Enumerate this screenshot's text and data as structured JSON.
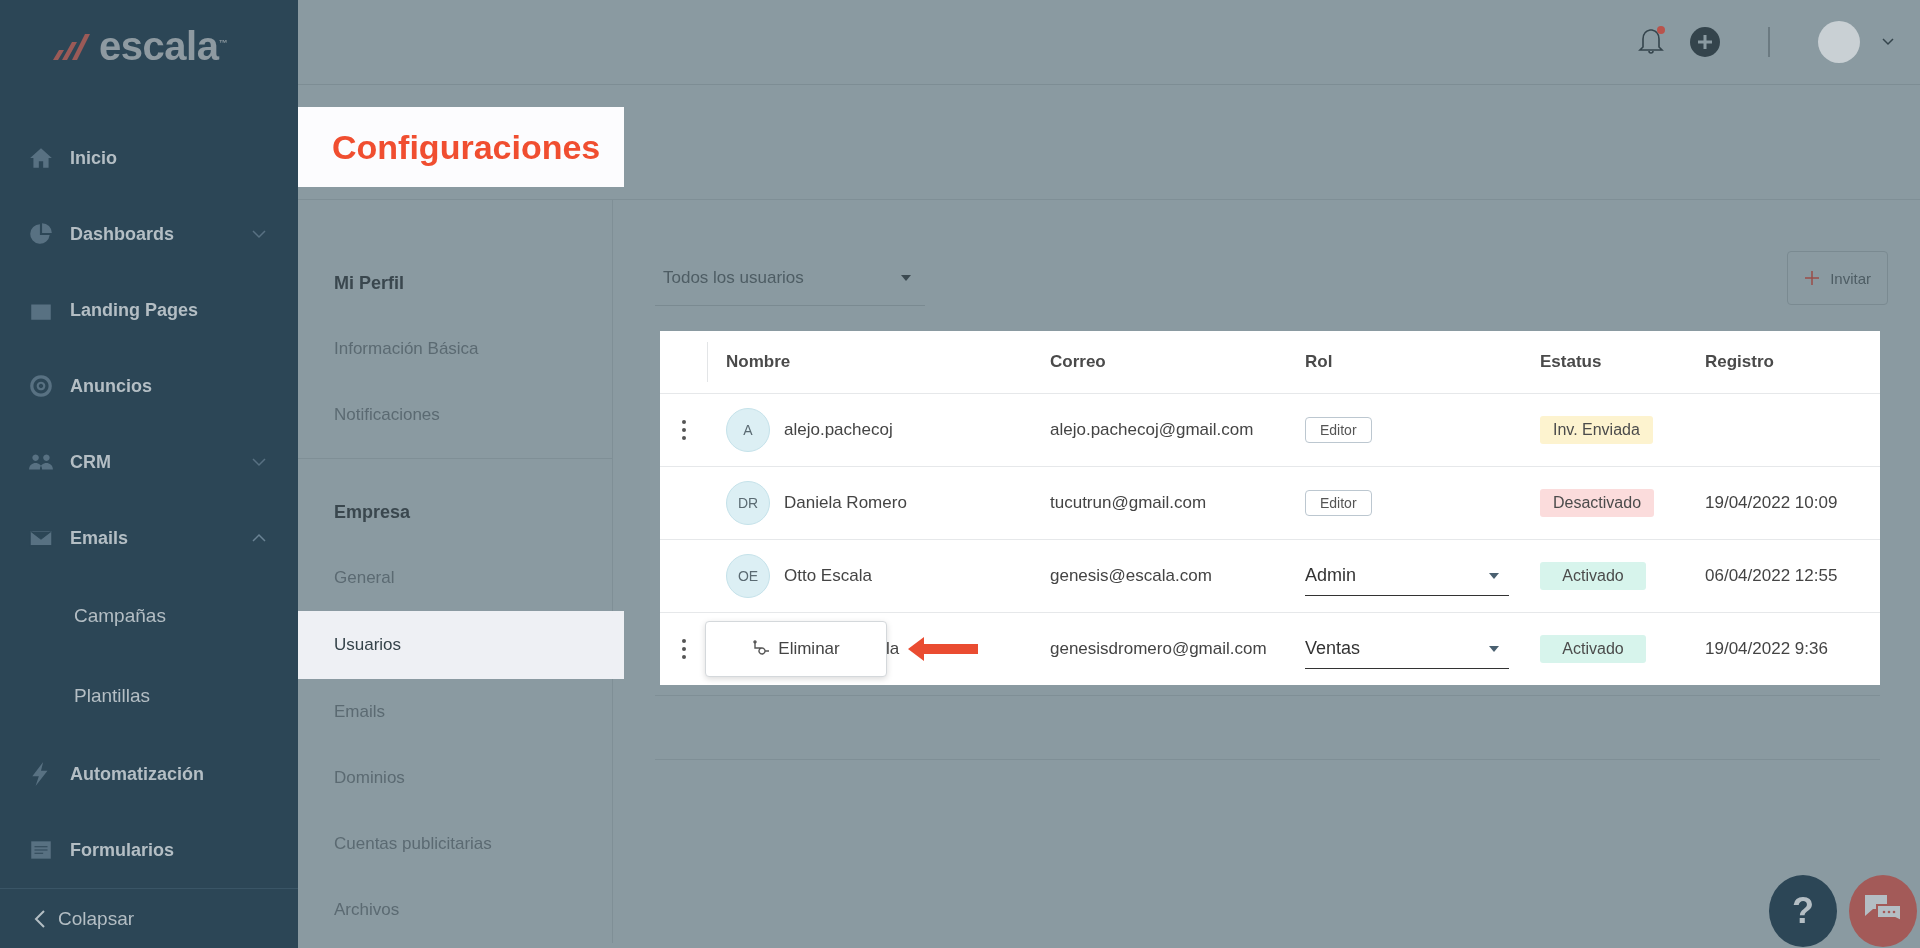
{
  "brand": {
    "name": "escala$^{™}$"
  },
  "sidebar": {
    "items": [
      {
        "label": "Inicio"
      },
      {
        "label": "Dashboards",
        "expanded": false
      },
      {
        "label": "Landing Pages"
      },
      {
        "label": "Anuncios"
      },
      {
        "label": "CRM",
        "expanded": false
      },
      {
        "label": "Emails",
        "expanded": true,
        "children": [
          {
            "label": "Campañas"
          },
          {
            "label": "Plantillas"
          }
        ]
      },
      {
        "label": "Automatización"
      },
      {
        "label": "Formularios"
      }
    ],
    "collapse_label": "Colapsar"
  },
  "topbar": {
    "notifications_unread": true
  },
  "page_title": "Configuraciones",
  "settings_nav": {
    "sections": [
      {
        "heading": "Mi Perfil",
        "items": [
          {
            "label": "Información Básica",
            "selected": false
          },
          {
            "label": "Notificaciones",
            "selected": false
          }
        ]
      },
      {
        "heading": "Empresa",
        "items": [
          {
            "label": "General",
            "selected": false
          },
          {
            "label": "Usuarios",
            "selected": true
          },
          {
            "label": "Emails",
            "selected": false
          },
          {
            "label": "Dominios",
            "selected": false
          },
          {
            "label": "Cuentas publicitarias",
            "selected": false
          },
          {
            "label": "Archivos",
            "selected": false
          }
        ]
      }
    ]
  },
  "filter": {
    "value": "Todos los usuarios"
  },
  "invite_button": {
    "label": "Invitar"
  },
  "table": {
    "columns": [
      "Nombre",
      "Correo",
      "Rol",
      "Estatus",
      "Registro"
    ],
    "rows": [
      {
        "menu_dots": true,
        "menu_open": false,
        "initials": "A",
        "name": "alejo.pachecoj",
        "email": "alejo.pachecoj@gmail.com",
        "role": {
          "kind": "tag",
          "label": "Editor"
        },
        "status": {
          "label": "Inv. Enviada",
          "color": "#fdf3cf"
        }
      },
      {
        "menu_dots": false,
        "menu_open": false,
        "initials": "DR",
        "name": "Daniela Romero",
        "email": "tucutrun@gmail.com",
        "role": {
          "kind": "tag",
          "label": "Editor"
        },
        "status": {
          "label": "Desactivado",
          "color": "#fbdcdc"
        },
        "registered": "19/04/2022 10:09"
      },
      {
        "menu_dots": false,
        "menu_open": false,
        "initials": "OE",
        "name": "Otto Escala",
        "email": "genesis@escala.com",
        "role": {
          "kind": "select",
          "label": "Admin"
        },
        "status": {
          "label": "Activado",
          "color": "#d7f4ec"
        },
        "registered": "06/04/2022 12:55"
      },
      {
        "menu_dots": true,
        "menu_open": true,
        "name": "la",
        "email": "genesisdromero@gmail.com",
        "role": {
          "kind": "select",
          "label": "Ventas"
        },
        "status": {
          "label": "Activado",
          "color": "#d7f4ec"
        },
        "registered": "19/04/2022 9:36"
      }
    ],
    "row_menu": {
      "label": "Eliminar"
    }
  },
  "help_button": {
    "label": "?"
  }
}
